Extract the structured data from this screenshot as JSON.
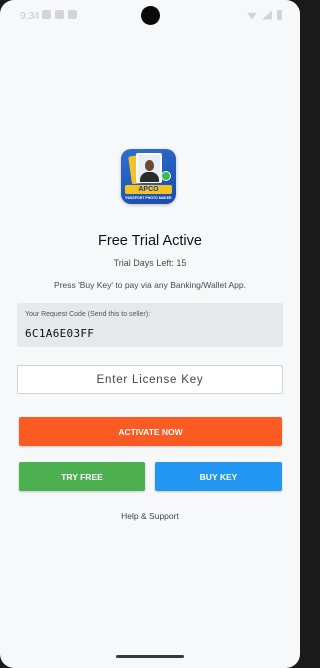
{
  "status_bar": {
    "time": "9:34"
  },
  "app": {
    "logo_text": "APCO",
    "logo_subtext": "PASSPORT PHOTO MAKER"
  },
  "trial": {
    "title": "Free Trial Active",
    "days_left": "Trial Days Left: 15",
    "instruction": "Press 'Buy Key' to pay via any Banking/Wallet App."
  },
  "request": {
    "label": "Your Request Code (Send this to seller):",
    "code": "6C1A6E03FF"
  },
  "license": {
    "placeholder": "Enter License Key",
    "value": ""
  },
  "buttons": {
    "activate": "ACTIVATE NOW",
    "try_free": "TRY FREE",
    "buy_key": "BUY KEY"
  },
  "help": "Help & Support",
  "colors": {
    "activate": "#fb5a23",
    "try_free": "#4caf50",
    "buy_key": "#2196f3"
  }
}
